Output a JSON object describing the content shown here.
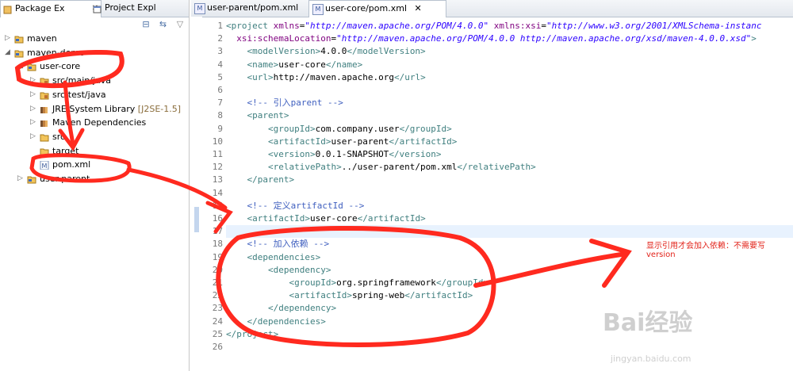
{
  "left_tabs": [
    {
      "label": "Package Ex",
      "active": true
    },
    {
      "label": "Project Expl",
      "active": false
    }
  ],
  "tree": [
    {
      "label": "maven",
      "suffix": "",
      "depth": 0,
      "arrow": "▷",
      "icon": "project-folder-icon"
    },
    {
      "label": "maven-demo",
      "suffix": "",
      "depth": 0,
      "arrow": "◢",
      "icon": "project-folder-icon"
    },
    {
      "label": "user-core",
      "suffix": "",
      "depth": 1,
      "arrow": "◢",
      "icon": "project-folder-icon"
    },
    {
      "label": "src/main/java",
      "suffix": "",
      "depth": 2,
      "arrow": "▷",
      "icon": "source-folder-icon"
    },
    {
      "label": "src/test/java",
      "suffix": "",
      "depth": 2,
      "arrow": "▷",
      "icon": "source-folder-icon"
    },
    {
      "label": "JRE System Library",
      "suffix": " [J2SE-1.5]",
      "depth": 2,
      "arrow": "▷",
      "icon": "library-icon"
    },
    {
      "label": "Maven Dependencies",
      "suffix": "",
      "depth": 2,
      "arrow": "▷",
      "icon": "library-icon"
    },
    {
      "label": "src",
      "suffix": "",
      "depth": 2,
      "arrow": "▷",
      "icon": "folder-icon"
    },
    {
      "label": "target",
      "suffix": "",
      "depth": 2,
      "arrow": "",
      "icon": "folder-icon"
    },
    {
      "label": "pom.xml",
      "suffix": "",
      "depth": 2,
      "arrow": "",
      "icon": "xml-file-icon"
    },
    {
      "label": "user-parent",
      "suffix": "",
      "depth": 1,
      "arrow": "▷",
      "icon": "project-folder-icon"
    }
  ],
  "editor_tabs": [
    {
      "label": "user-parent/pom.xml",
      "active": false
    },
    {
      "label": "user-core/pom.xml",
      "active": true
    }
  ],
  "code_lines": [
    [
      [
        "t",
        "<project "
      ],
      [
        "a",
        "xmlns"
      ],
      [
        "p",
        "="
      ],
      [
        "v",
        "\"http://maven.apache.org/POM/4.0.0\""
      ],
      [
        "p",
        " "
      ],
      [
        "a",
        "xmlns:xsi"
      ],
      [
        "p",
        "="
      ],
      [
        "v",
        "\"http://www.w3.org/2001/XMLSchema-instanc"
      ]
    ],
    [
      [
        "p",
        "  "
      ],
      [
        "a",
        "xsi:schemaLocation"
      ],
      [
        "p",
        "="
      ],
      [
        "v",
        "\"http://maven.apache.org/POM/4.0.0 http://maven.apache.org/xsd/maven-4.0.0.xsd\""
      ],
      [
        "t",
        ">"
      ]
    ],
    [
      [
        "p",
        "    "
      ],
      [
        "t",
        "<modelVersion>"
      ],
      [
        "p",
        "4.0.0"
      ],
      [
        "t",
        "</modelVersion>"
      ]
    ],
    [
      [
        "p",
        "    "
      ],
      [
        "t",
        "<name>"
      ],
      [
        "p",
        "user-core"
      ],
      [
        "t",
        "</name>"
      ]
    ],
    [
      [
        "p",
        "    "
      ],
      [
        "t",
        "<url>"
      ],
      [
        "p",
        "http://maven.apache.org"
      ],
      [
        "t",
        "</url>"
      ]
    ],
    [
      [
        "p",
        ""
      ]
    ],
    [
      [
        "p",
        "    "
      ],
      [
        "c",
        "<!-- 引入parent -->"
      ]
    ],
    [
      [
        "p",
        "    "
      ],
      [
        "t",
        "<parent>"
      ]
    ],
    [
      [
        "p",
        "        "
      ],
      [
        "t",
        "<groupId>"
      ],
      [
        "p",
        "com.company.user"
      ],
      [
        "t",
        "</groupId>"
      ]
    ],
    [
      [
        "p",
        "        "
      ],
      [
        "t",
        "<artifactId>"
      ],
      [
        "p",
        "user-parent"
      ],
      [
        "t",
        "</artifactId>"
      ]
    ],
    [
      [
        "p",
        "        "
      ],
      [
        "t",
        "<version>"
      ],
      [
        "p",
        "0.0.1-SNAPSHOT"
      ],
      [
        "t",
        "</version>"
      ]
    ],
    [
      [
        "p",
        "        "
      ],
      [
        "t",
        "<relativePath>"
      ],
      [
        "p",
        "../user-parent/pom.xml"
      ],
      [
        "t",
        "</relativePath>"
      ]
    ],
    [
      [
        "p",
        "    "
      ],
      [
        "t",
        "</parent>"
      ]
    ],
    [
      [
        "p",
        ""
      ]
    ],
    [
      [
        "p",
        "    "
      ],
      [
        "c",
        "<!-- 定义artifactId -->"
      ]
    ],
    [
      [
        "p",
        "    "
      ],
      [
        "t",
        "<artifactId>"
      ],
      [
        "p",
        "user-core"
      ],
      [
        "t",
        "</artifactId>"
      ]
    ],
    [
      [
        "p",
        ""
      ]
    ],
    [
      [
        "p",
        "    "
      ],
      [
        "c",
        "<!-- 加入依赖 -->"
      ]
    ],
    [
      [
        "p",
        "    "
      ],
      [
        "t",
        "<dependencies>"
      ]
    ],
    [
      [
        "p",
        "        "
      ],
      [
        "t",
        "<dependency>"
      ]
    ],
    [
      [
        "p",
        "            "
      ],
      [
        "t",
        "<groupId>"
      ],
      [
        "p",
        "org.springframework"
      ],
      [
        "t",
        "</groupId>"
      ]
    ],
    [
      [
        "p",
        "            "
      ],
      [
        "t",
        "<artifactId>"
      ],
      [
        "p",
        "spring-web"
      ],
      [
        "t",
        "</artifactId>"
      ]
    ],
    [
      [
        "p",
        "        "
      ],
      [
        "t",
        "</dependency>"
      ]
    ],
    [
      [
        "p",
        "    "
      ],
      [
        "t",
        "</dependencies>"
      ]
    ],
    [
      [
        "t",
        "</project>"
      ]
    ],
    [
      [
        "p",
        ""
      ]
    ]
  ],
  "line_numbers": [
    "1",
    "2",
    "3",
    "4",
    "5",
    "6",
    "7",
    "8",
    "9",
    "10",
    "11",
    "12",
    "13",
    "14",
    "15",
    "16",
    "17",
    "18",
    "19",
    "20",
    "21",
    "22",
    "23",
    "24",
    "25",
    "26"
  ],
  "annotation": {
    "line1": "显示引用才会加入依赖：不需要写",
    "line2": "version"
  },
  "watermark": {
    "brand": "Bai经验",
    "url": "jingyan.baidu.com"
  }
}
